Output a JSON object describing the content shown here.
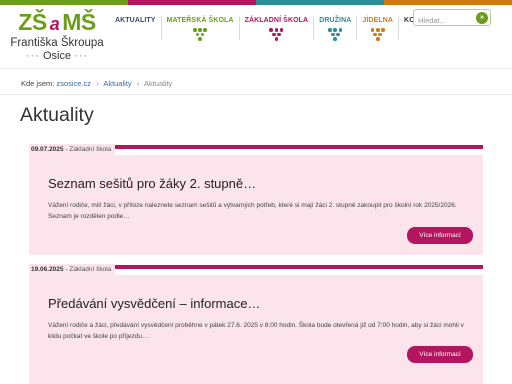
{
  "colors": {
    "green": "#6a9e1a",
    "magenta": "#b3165e",
    "teal": "#2a8f96",
    "orange": "#d07a10",
    "pink_bg": "#fbe4ec",
    "link": "#3a6aa0"
  },
  "logo": {
    "left": "ZŠ",
    "amp": "a",
    "right": "MŠ",
    "line1": "Františka Škroupa",
    "line2": "Osice",
    "dots": "···"
  },
  "nav": [
    {
      "label": "AKTUALITY",
      "color": "#3a4a6b",
      "grapes": ""
    },
    {
      "label": "MATEŘSKÁ ŠKOLA",
      "color": "#6a9e1a",
      "grapes": "#6a9e1a"
    },
    {
      "label": "ZÁKLADNÍ ŠKOLA",
      "color": "#b3165e",
      "grapes": "#b3165e"
    },
    {
      "label": "DRUŽINA",
      "color": "#2a8f96",
      "grapes": "#2a8f96"
    },
    {
      "label": "JÍDELNA",
      "color": "#d07a10",
      "grapes": "#d07a10"
    },
    {
      "label": "KONTAKT",
      "color": "#333333",
      "grapes": ""
    }
  ],
  "search": {
    "placeholder": "Hledat...",
    "icon": "arrow-right-icon",
    "go_glyph": "»"
  },
  "breadcrumb": {
    "prefix": "Kde jsem:",
    "items": [
      "zsosice.cz",
      "Aktuality"
    ],
    "current": "Aktuality",
    "separator": "›"
  },
  "page_title": "Aktuality",
  "articles": [
    {
      "date": "09.07.2025",
      "category": "Základní škola",
      "title": "Seznam sešitů pro žáky 2. stupně…",
      "excerpt": "Vážení rodiče, milí žáci, v příloze naleznete seznam sešitů a výtvarných potřeb, které si mají žáci 2. stupně zakoupit pro školní rok 2025/2026. Seznam je rozdělen podle…",
      "more_label": "Více informací"
    },
    {
      "date": "19.06.2025",
      "category": "Základní škola",
      "title": "Předávání vysvědčení – informace…",
      "excerpt": "Vážení rodiče a žáci, předávání vysvědčení proběhne v pátek 27.6. 2025 v 8:00 hodin. Škola bude otevřená již od 7:00 hodin, aby si žáci mohli v klidu počkat ve škole po příjezdu…",
      "more_label": "Více informací"
    }
  ]
}
